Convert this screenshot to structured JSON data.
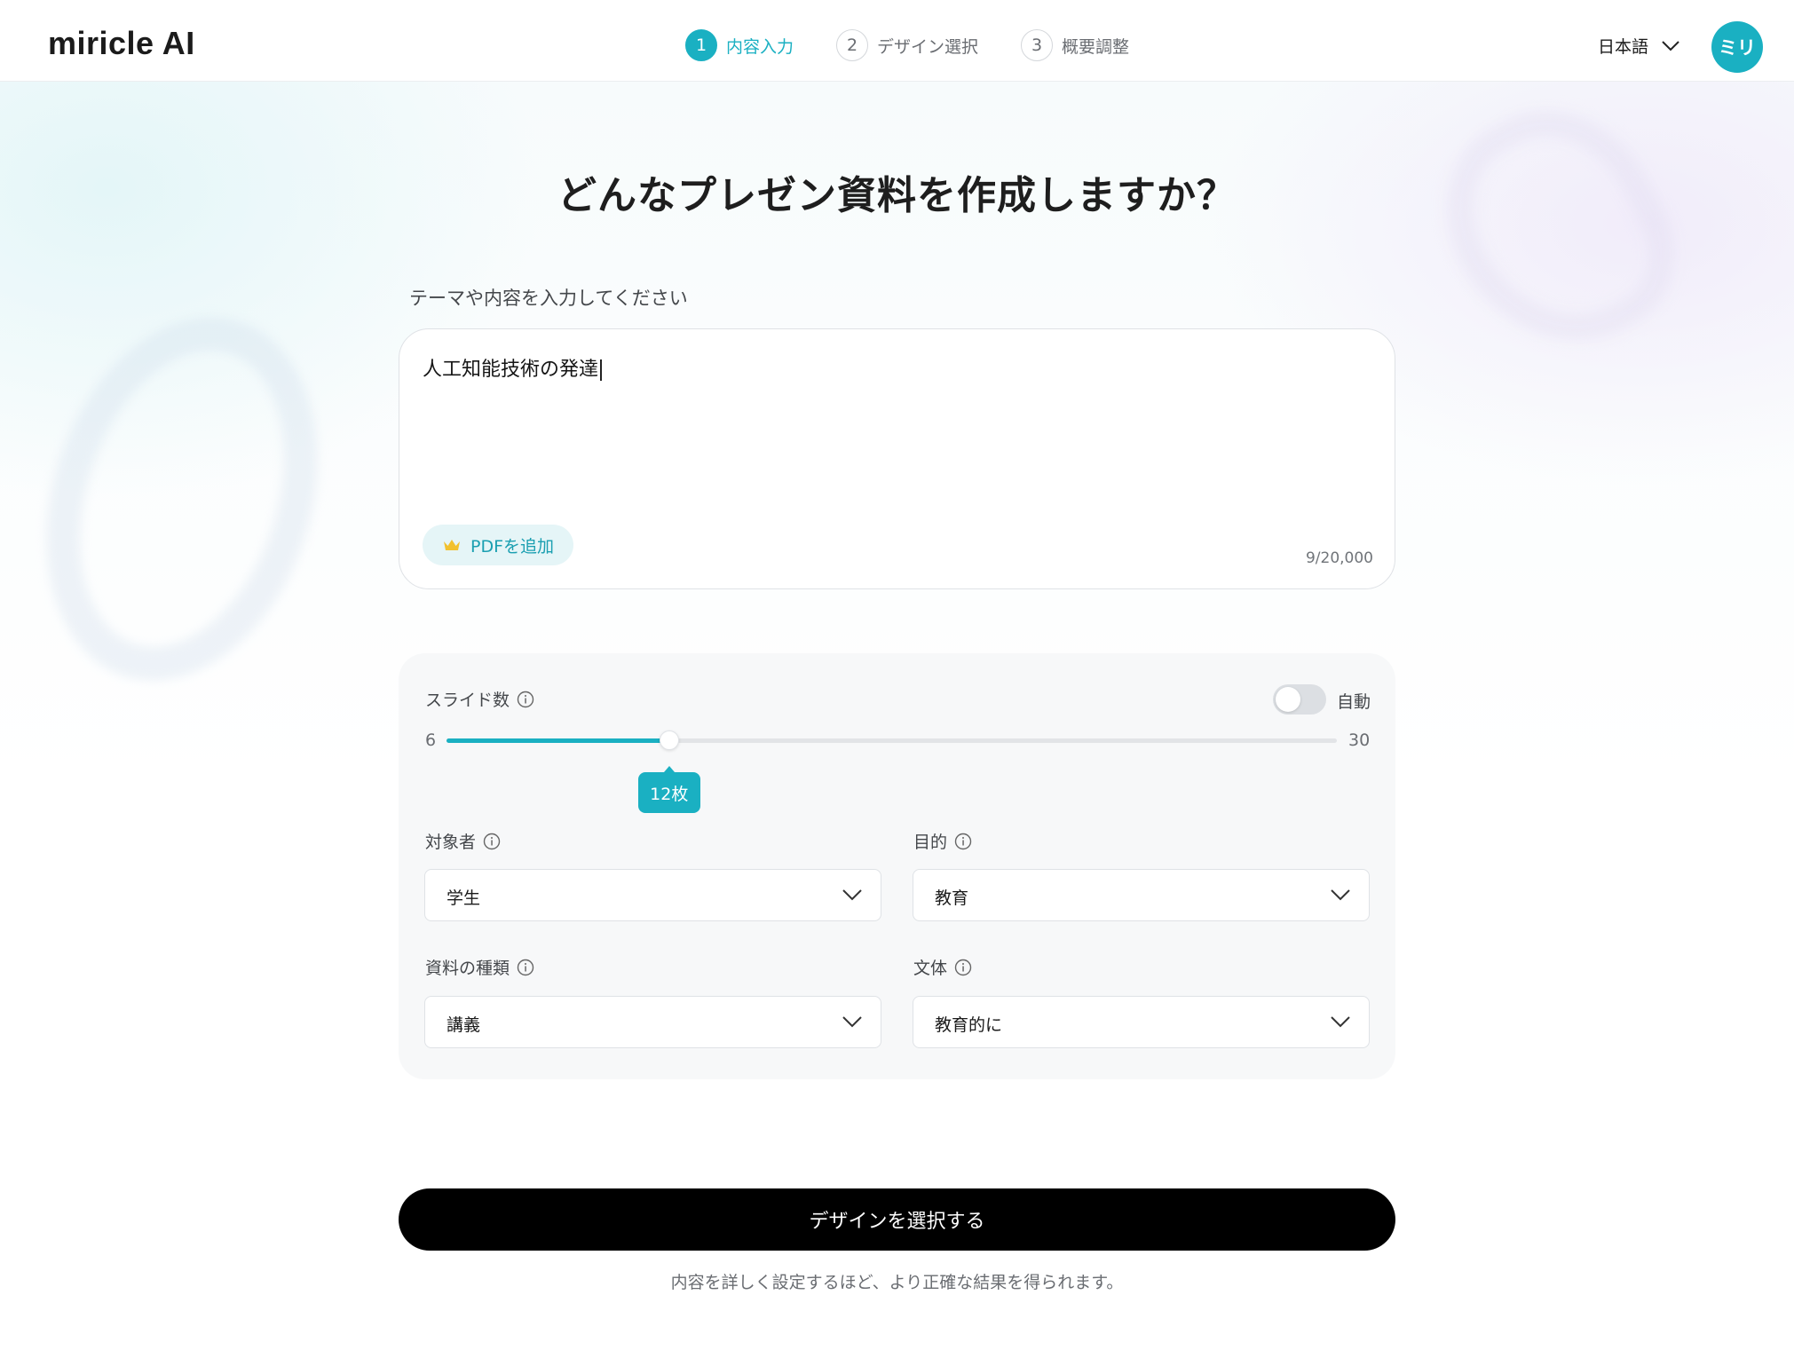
{
  "header": {
    "logo": "miricle AI",
    "steps": [
      {
        "num": "1",
        "label": "内容入力"
      },
      {
        "num": "2",
        "label": "デザイン選択"
      },
      {
        "num": "3",
        "label": "概要調整"
      }
    ],
    "language": "日本語",
    "avatar": "ミリ"
  },
  "main": {
    "title": "どんなプレゼン資料を作成しますか？",
    "prompt_label": "テーマや内容を入力してください",
    "prompt_value": "人工知能技術の発達",
    "pdf_button": "PDFを追加",
    "char_count": "9/20,000"
  },
  "settings": {
    "slides_label": "スライド数",
    "auto_label": "自動",
    "auto_enabled": false,
    "range_min": "6",
    "range_max": "30",
    "slides_min_value": 6,
    "slides_max_value": 30,
    "slides_value": 12,
    "slides_bubble": "12枚",
    "audience_label": "対象者",
    "audience_value": "学生",
    "purpose_label": "目的",
    "purpose_value": "教育",
    "doc_type_label": "資料の種類",
    "doc_type_value": "講義",
    "style_label": "文体",
    "style_value": "教育的に"
  },
  "footer": {
    "cta": "デザインを選択する",
    "hint": "内容を詳しく設定するほど、より正確な結果を得られます。"
  },
  "colors": {
    "accent": "#1ab0c2",
    "cta": "#000000"
  }
}
